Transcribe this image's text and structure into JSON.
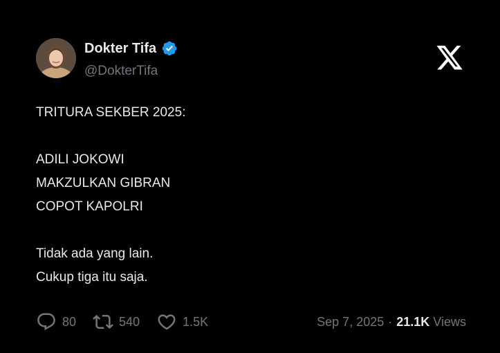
{
  "author": {
    "display_name": "Dokter Tifa",
    "handle": "@DokterTifa",
    "verified": true,
    "verified_color": "#1d9bf0"
  },
  "logo": "x-logo-icon",
  "tweet": {
    "lines": [
      "TRITURA SEKBER 2025:",
      "",
      "ADILI JOKOWI",
      "MAKZULKAN GIBRAN",
      "COPOT KAPOLRI",
      "",
      "Tidak ada yang lain.",
      "Cukup tiga itu saja."
    ]
  },
  "stats": {
    "replies": "80",
    "reposts": "540",
    "likes": "1.5K",
    "date": "Sep 7, 2025",
    "separator": "·",
    "views_count": "21.1K",
    "views_label": "Views"
  },
  "colors": {
    "background": "#000000",
    "text": "#e7e9ea",
    "secondary": "#71767b"
  }
}
